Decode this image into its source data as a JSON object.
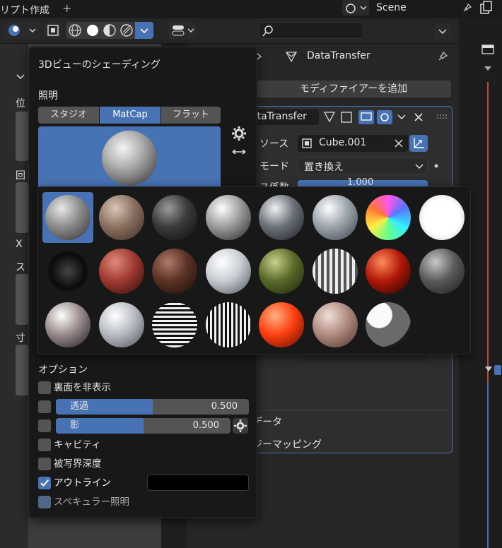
{
  "topbar": {
    "tab_title": "リプト作成",
    "add_tab": "+",
    "scene_label": "Scene"
  },
  "viewport": {
    "side_labels": [
      "位",
      "回",
      "X",
      "ス",
      "寸"
    ]
  },
  "properties": {
    "breadcrumb": "DataTransfer",
    "add_modifier": "モディファイアーを追加",
    "modifier_name": "ataTransfer",
    "source_label": "ソース",
    "source_value": "Cube.001",
    "mode_label": "モード",
    "mode_value": "置き換え",
    "factor_label": "ス係数",
    "factor_value": "1.000",
    "face_data": "データ",
    "topology_mapping": "ジーマッピング"
  },
  "shading_popup": {
    "title": "3Dビューのシェーディング",
    "lighting_label": "照明",
    "lighting_modes": [
      "スタジオ",
      "MatCap",
      "フラット"
    ],
    "active_mode": "MatCap",
    "options_label": "オプション",
    "backface_culling": "裏面を非表示",
    "xray_label": "透過",
    "xray_value": "0.500",
    "xray_fraction": 0.5,
    "shadow_label": "影",
    "shadow_value": "0.500",
    "shadow_fraction": 0.5,
    "cavity": "キャビティ",
    "depth_of_field": "被写界深度",
    "outline": "アウトライン",
    "outline_color": "#000000",
    "specular": "スペキュラー照明"
  },
  "matcaps": [
    {
      "name": "basic_1",
      "colors": [
        "#e8e8e8",
        "#8a8a8a",
        "#2e2e2e"
      ],
      "selected": true
    },
    {
      "name": "basic_2",
      "colors": [
        "#d8c6b8",
        "#8a6f5f",
        "#3a2a22"
      ]
    },
    {
      "name": "basic_dark",
      "colors": [
        "#9a9a9a",
        "#3a3a3a",
        "#0d0d0d"
      ]
    },
    {
      "name": "basic_side",
      "colors": [
        "#ffffff",
        "#9a9a9a",
        "#222222"
      ]
    },
    {
      "name": "ceramic_dark",
      "colors": [
        "#f0f0f0",
        "#6a7078",
        "#1a1c20"
      ]
    },
    {
      "name": "ceramic_lightbulb",
      "colors": [
        "#ffffff",
        "#9aa2aa",
        "#3a4048"
      ]
    },
    {
      "name": "check_normal",
      "colors": [
        "#ff66ff",
        "#33ddff",
        "#8844ff"
      ]
    },
    {
      "name": "check_rim_light",
      "colors": [
        "#ffffff",
        "#e8e8e8",
        "#1a1a1a"
      ]
    },
    {
      "name": "check_rim_dark",
      "colors": [
        "#555555",
        "#0a0a0a",
        "#eeeeee"
      ]
    },
    {
      "name": "clay_brown",
      "colors": [
        "#e08a7a",
        "#a03a32",
        "#2a0c0a"
      ]
    },
    {
      "name": "clay_muddy",
      "colors": [
        "#b07a6a",
        "#5a3226",
        "#1a0c08"
      ]
    },
    {
      "name": "clay_studio",
      "colors": [
        "#ffffff",
        "#c8ccd2",
        "#4a4e56"
      ]
    },
    {
      "name": "jade",
      "colors": [
        "#c8d088",
        "#5a6a2a",
        "#1a220a"
      ]
    },
    {
      "name": "metal_anisotropic",
      "colors": [
        "#ffffff",
        "#8a8a8a",
        "#1a1a1a"
      ]
    },
    {
      "name": "metal_carpaint",
      "colors": [
        "#ff8a5a",
        "#b01808",
        "#1a0402"
      ]
    },
    {
      "name": "metal_lead",
      "colors": [
        "#c8c8c8",
        "#5a5a5a",
        "#1a1a1a"
      ]
    },
    {
      "name": "metal_shiny",
      "colors": [
        "#ffffff",
        "#9a8a8a",
        "#1a1a22"
      ]
    },
    {
      "name": "pearl",
      "colors": [
        "#ffffff",
        "#b8bcc2",
        "#4a4e56"
      ]
    },
    {
      "name": "reflection_check_horizontal",
      "colors": [
        "#ffffff",
        "#888888",
        "#111111"
      ]
    },
    {
      "name": "reflection_check_vertical",
      "colors": [
        "#ffffff",
        "#888888",
        "#111111"
      ]
    },
    {
      "name": "resin",
      "colors": [
        "#ffb080",
        "#ff4010",
        "#5a0a00"
      ]
    },
    {
      "name": "skin",
      "colors": [
        "#f0e0d8",
        "#b08a80",
        "#4a3028"
      ]
    },
    {
      "name": "toon",
      "colors": [
        "#f4f4f4",
        "#5a5a5a",
        "#1a1a1a"
      ]
    }
  ],
  "colors": {
    "accent": "#4772b3",
    "panel": "#181818",
    "button": "#545454"
  }
}
